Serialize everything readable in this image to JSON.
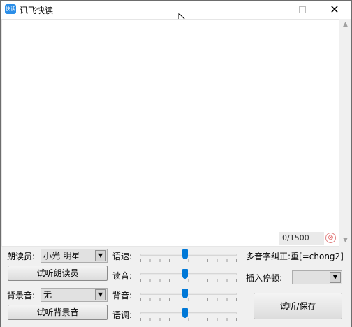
{
  "window": {
    "title": "讯飞快读",
    "icon_text": "快读",
    "controls": {
      "minimize": "minimize-icon",
      "maximize": "maximize-icon",
      "close": "✕"
    }
  },
  "editor": {
    "text": "",
    "counter": "0/1500",
    "clear_icon": "⊗",
    "scroll_up": "▲",
    "scroll_down": "▼"
  },
  "reader": {
    "label": "朗读员:",
    "selected": "小光-明星",
    "preview_button": "试听朗读员"
  },
  "background": {
    "label": "背景音:",
    "selected": "无",
    "preview_button": "试听背景音"
  },
  "sliders": [
    {
      "label": "语速:",
      "level": 0.46
    },
    {
      "label": "读音:",
      "level": 0.46
    },
    {
      "label": "背音:",
      "level": 0.46
    },
    {
      "label": "语调:",
      "level": 0.46
    }
  ],
  "polyphone": {
    "label": "多音字纠正:",
    "example": "重[=chong2]"
  },
  "pause": {
    "label": "插入停顿:",
    "selected": ""
  },
  "save_button": "试听/保存",
  "combo_arrow": "▼"
}
